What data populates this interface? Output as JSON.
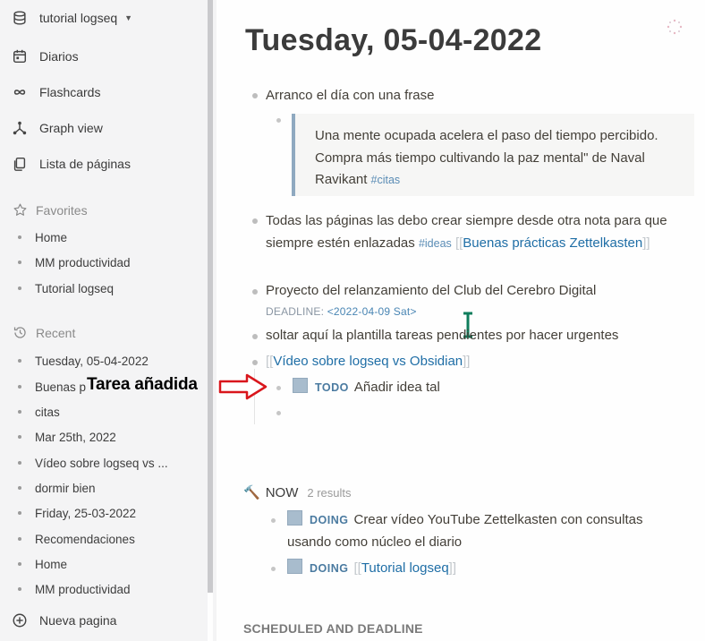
{
  "sidebar": {
    "graph_name": "tutorial logseq",
    "nav": [
      {
        "label": "Diarios",
        "icon": "calendar-icon"
      },
      {
        "label": "Flashcards",
        "icon": "infinity-icon"
      },
      {
        "label": "Graph view",
        "icon": "graph-icon"
      },
      {
        "label": "Lista de páginas",
        "icon": "pages-icon"
      }
    ],
    "favorites_title": "Favorites",
    "favorites": [
      "Home",
      "MM productividad",
      "Tutorial logseq"
    ],
    "recent_title": "Recent",
    "recent": [
      "Tuesday, 05-04-2022",
      "Buenas p",
      "citas",
      "Mar 25th, 2022",
      "Vídeo sobre logseq vs ...",
      "dormir bien",
      "Friday, 25-03-2022",
      "Recomendaciones",
      "Home",
      "MM productividad"
    ],
    "new_page_label": "Nueva pagina"
  },
  "annotation": {
    "label": "Tarea añadida",
    "arrow_color": "#d9161c"
  },
  "page": {
    "title": "Tuesday, 05-04-2022",
    "blocks": {
      "b1": "Arranco el día con una frase",
      "quote_text": "Una mente ocupada acelera el paso del tiempo percibido. Compra más tiempo cultivando la paz mental\" de Naval Ravikant ",
      "quote_tag": "#citas",
      "b2_text": "Todas las páginas las debo crear siempre desde otra nota para que siempre estén enlazadas ",
      "b2_tag": "#ideas",
      "b2_link": "Buenas prácticas Zettelkasten",
      "b3_text": "Proyecto del relanzamiento del Club del Cerebro Digital",
      "b3_deadline_label": "DEADLINE: ",
      "b3_deadline_value": "<2022-04-09 Sat>",
      "b4": "soltar aquí la plantilla tareas pendientes por hacer urgentes",
      "b5_link": "Vídeo sobre logseq vs Obsidian",
      "todo_marker": "TODO",
      "todo_text": "Añadir idea tal"
    },
    "now": {
      "title": "NOW",
      "count": "2 results",
      "items": [
        {
          "marker": "DOING",
          "text": "Crear vídeo YouTube Zettelkasten con consultas usando como núcleo el diario"
        },
        {
          "marker": "DOING",
          "link": "Tutorial logseq"
        }
      ]
    },
    "scheduled_title": "SCHEDULED AND DEADLINE"
  }
}
